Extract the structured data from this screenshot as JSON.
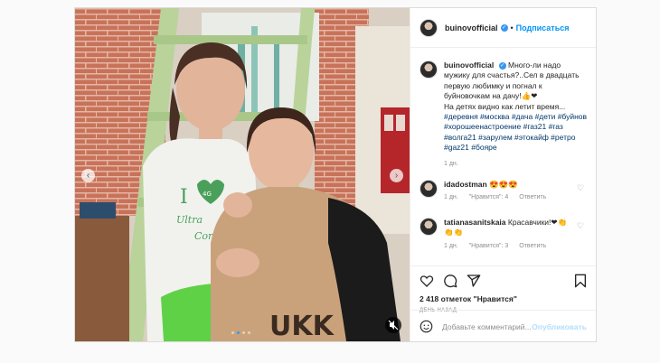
{
  "post": {
    "username": "buinovofficial",
    "verified_mark": "✓",
    "header_dot": "•",
    "follow_label": "Подписаться"
  },
  "caption": {
    "username": "buinovofficial",
    "text": "Много-ли надо мужику для счастья?..Сел в двадцать первую любимку и погнал к буйновочкам на дачу!👍❤",
    "text2": "На детях видно как летит время...",
    "hashtags": "#деревня #москва #дача #дети #буйнов #хорошеенастроение #газ21 #газ #волга21 #зарулем #этокайф #ретро #gaz21 #бояре",
    "age": "1 дн."
  },
  "comments": [
    {
      "username": "idadostman",
      "text": "😍😍😍",
      "age": "1 дн.",
      "likes": "\"Нравится\": 4",
      "reply": "Ответить"
    },
    {
      "username": "tatianasanitskaia",
      "text": "Красавчики!❤👏👏👏",
      "age": "1 дн.",
      "likes": "\"Нравится\": 3",
      "reply": "Ответить"
    }
  ],
  "actions": {
    "likes_text": "2 418 отметок \"Нравится\"",
    "time_ago": "ДЕНЬ НАЗАД",
    "icons": [
      "heart-icon",
      "comment-icon",
      "share-icon",
      "bookmark-icon"
    ]
  },
  "add_comment": {
    "placeholder": "Добавьте комментарий...",
    "publish_label": "Опубликовать",
    "icon": "smiley-icon"
  },
  "media": {
    "prev_arrow": "‹",
    "next_arrow": "›",
    "carousel_active_index": 1,
    "carousel_count": 4,
    "mute_icon": "speaker-muted-icon",
    "shirt_letter": "I",
    "shirt_badge": "4G",
    "shirt_script": "Ultra",
    "shirt_script2": "Comfort",
    "pants_text": "UKK"
  },
  "colors": {
    "accent": "#0095f6",
    "hashtag": "#00376b",
    "muted": "#8e8e8e",
    "wall_brick": "#c8725a",
    "ladder_green": "#b9d39a"
  }
}
